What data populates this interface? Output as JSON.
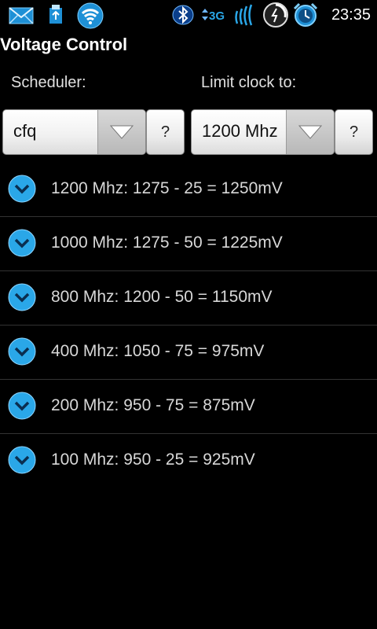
{
  "status_bar": {
    "time": "23:35",
    "network_type": "3G",
    "icons_left": [
      "mail-icon",
      "usb-icon",
      "wifi-icon"
    ],
    "icons_right": [
      "bluetooth-icon",
      "network-3g-icon",
      "signal-icon",
      "power-widget-icon",
      "alarm-icon"
    ]
  },
  "app": {
    "title": "Voltage Control"
  },
  "scheduler": {
    "label": "Scheduler:",
    "value": "cfq",
    "help_label": "?"
  },
  "clock_limit": {
    "label": "Limit clock to:",
    "value": "1200 Mhz",
    "help_label": "?"
  },
  "voltage_rows": [
    {
      "label": "1200 Mhz: 1275 - 25 = 1250mV"
    },
    {
      "label": "1000 Mhz: 1275 - 50 = 1225mV"
    },
    {
      "label": "800 Mhz: 1200 - 50 = 1150mV"
    },
    {
      "label": "400 Mhz: 1050 - 75 = 975mV"
    },
    {
      "label": "200 Mhz: 950 - 75 = 875mV"
    },
    {
      "label": "100 Mhz: 950 - 25 = 925mV"
    }
  ],
  "colors": {
    "accent_blue": "#2aa7e8",
    "background": "#000000",
    "divider": "#333333"
  }
}
